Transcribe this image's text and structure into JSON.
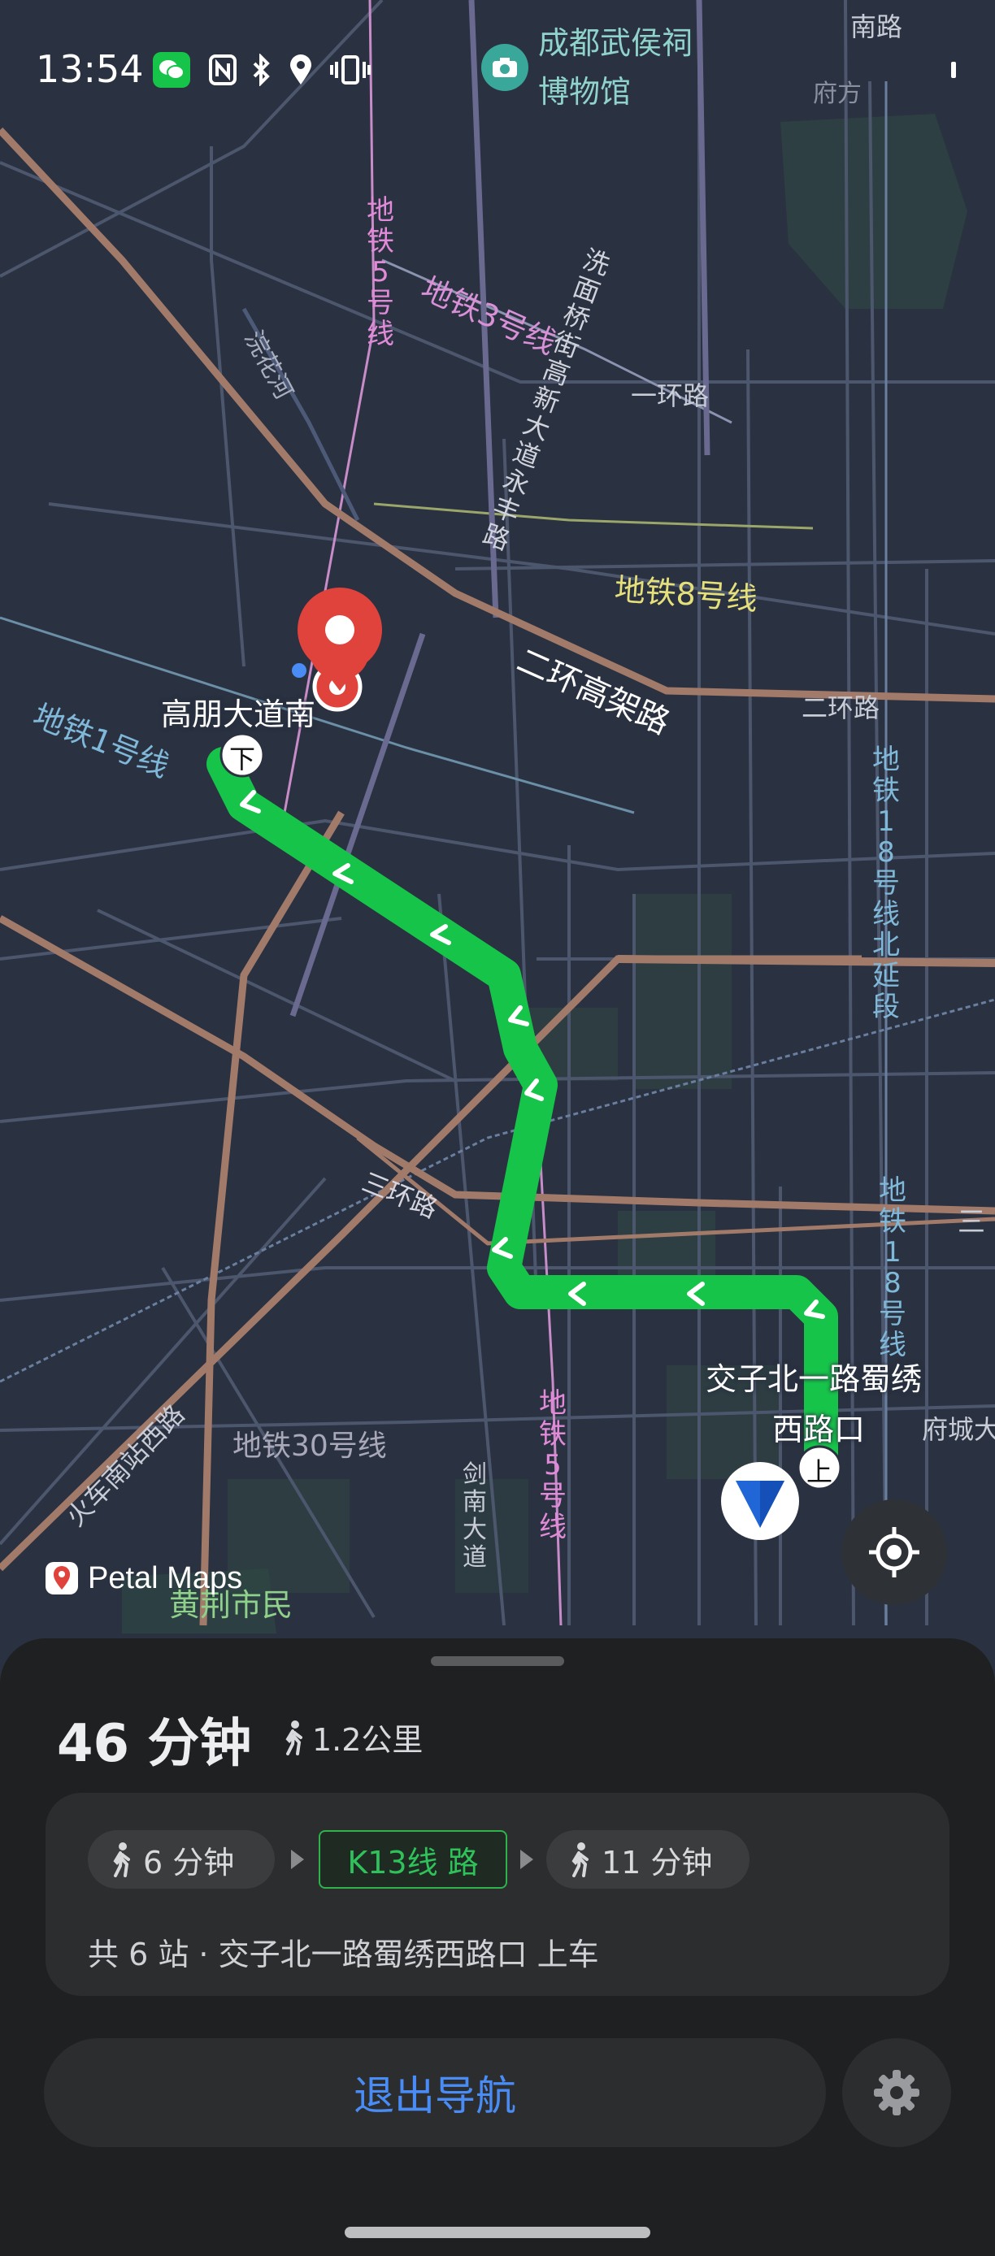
{
  "status_bar": {
    "time": "13:54",
    "icons": [
      "wechat-icon",
      "nfc-icon",
      "bluetooth-icon",
      "location-icon",
      "vibrate-icon"
    ]
  },
  "map": {
    "poi": "成都武侯祠博物馆",
    "poi_line1": "成都武侯祠",
    "poi_line2": "博物馆",
    "labels": {
      "yihuan": "一环路",
      "metro8": "地铁8号线",
      "erhuan_elevated": "二环高架路",
      "erhuan": "二环路",
      "metro1": "地铁1号线",
      "metro3": "地铁3号线",
      "sanhuan": "三环路",
      "sanhuan_right": "三",
      "metro30": "地铁30号线",
      "huochenanzhan": "火车南站西路",
      "huanhe": "浣花河",
      "fuchengda": "府城大",
      "shimin": "黄荆市民",
      "nan_lu": "南路",
      "fangting": "府方"
    },
    "vertical_labels": {
      "metro5_top": "地铁5号线",
      "metro5_bottom": "地铁5号线",
      "street_north": "洗面桥街高新大道永丰路",
      "metro18_north": "地铁18号线北延段",
      "metro18": "地铁18号线",
      "jiannan": "剑南大道"
    },
    "end_stop": "高朋大道南",
    "start_stop_line1": "交子北一路蜀绣",
    "start_stop_line2": "西路口",
    "alight_badge": "下",
    "board_badge": "上",
    "brand": "Petal Maps"
  },
  "sheet": {
    "duration": "46 分钟",
    "walk_distance": "1.2公里",
    "steps": [
      {
        "type": "walk",
        "label": "6 分钟"
      },
      {
        "type": "bus",
        "label": "K13线 路"
      },
      {
        "type": "walk",
        "label": "11 分钟"
      }
    ],
    "description": "共 6 站 · 交子北一路蜀绣西路口 上车",
    "exit_label": "退出导航"
  },
  "colors": {
    "route": "#17c44a",
    "accent_blue": "#4a8cf5",
    "pin_red": "#e0423c",
    "map_bg": "#2a3140"
  }
}
